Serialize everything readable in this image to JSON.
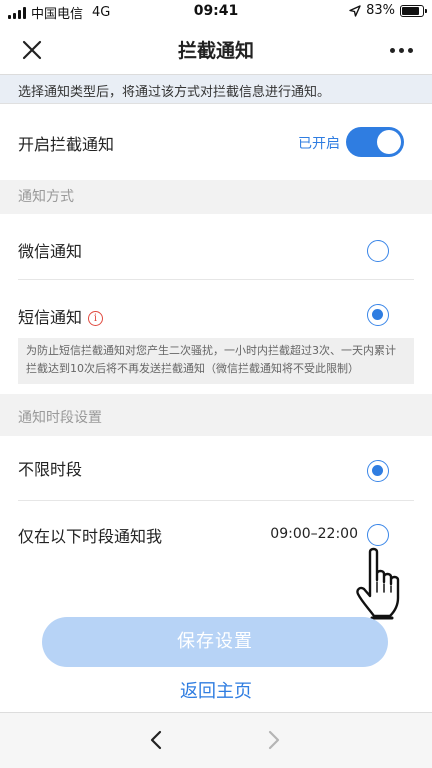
{
  "status_bar": {
    "carrier": "中国电信",
    "network": "4G",
    "time": "09:41",
    "battery": "83%",
    "battery_level": 0.83
  },
  "nav": {
    "title": "拦截通知",
    "close_icon": "close-icon",
    "more_icon": "more-icon"
  },
  "notice": "选择通知类型后，将通过该方式对拦截信息进行通知。",
  "enable_row": {
    "label": "开启拦截通知",
    "status": "已开启",
    "enabled": true
  },
  "method_section": {
    "header": "通知方式",
    "options": [
      {
        "label": "微信通知",
        "checked": false
      },
      {
        "label": "短信通知",
        "checked": true
      }
    ],
    "sms_note": "为防止短信拦截通知对您产生二次骚扰，一小时内拦截超过3次、一天内累计拦截达到10次后将不再发送拦截通知（微信拦截通知将不受此限制）"
  },
  "period_section": {
    "header": "通知时段设置",
    "options": [
      {
        "label": "不限时段",
        "checked": true
      },
      {
        "label": "仅在以下时段通知我",
        "checked": false,
        "range": "09:00–22:00"
      }
    ]
  },
  "actions": {
    "save": "保存设置",
    "back_home": "返回主页"
  },
  "colors": {
    "accent": "#2f7de1",
    "save_disabled": "#b7d3f6",
    "info": "#e04a3f"
  }
}
